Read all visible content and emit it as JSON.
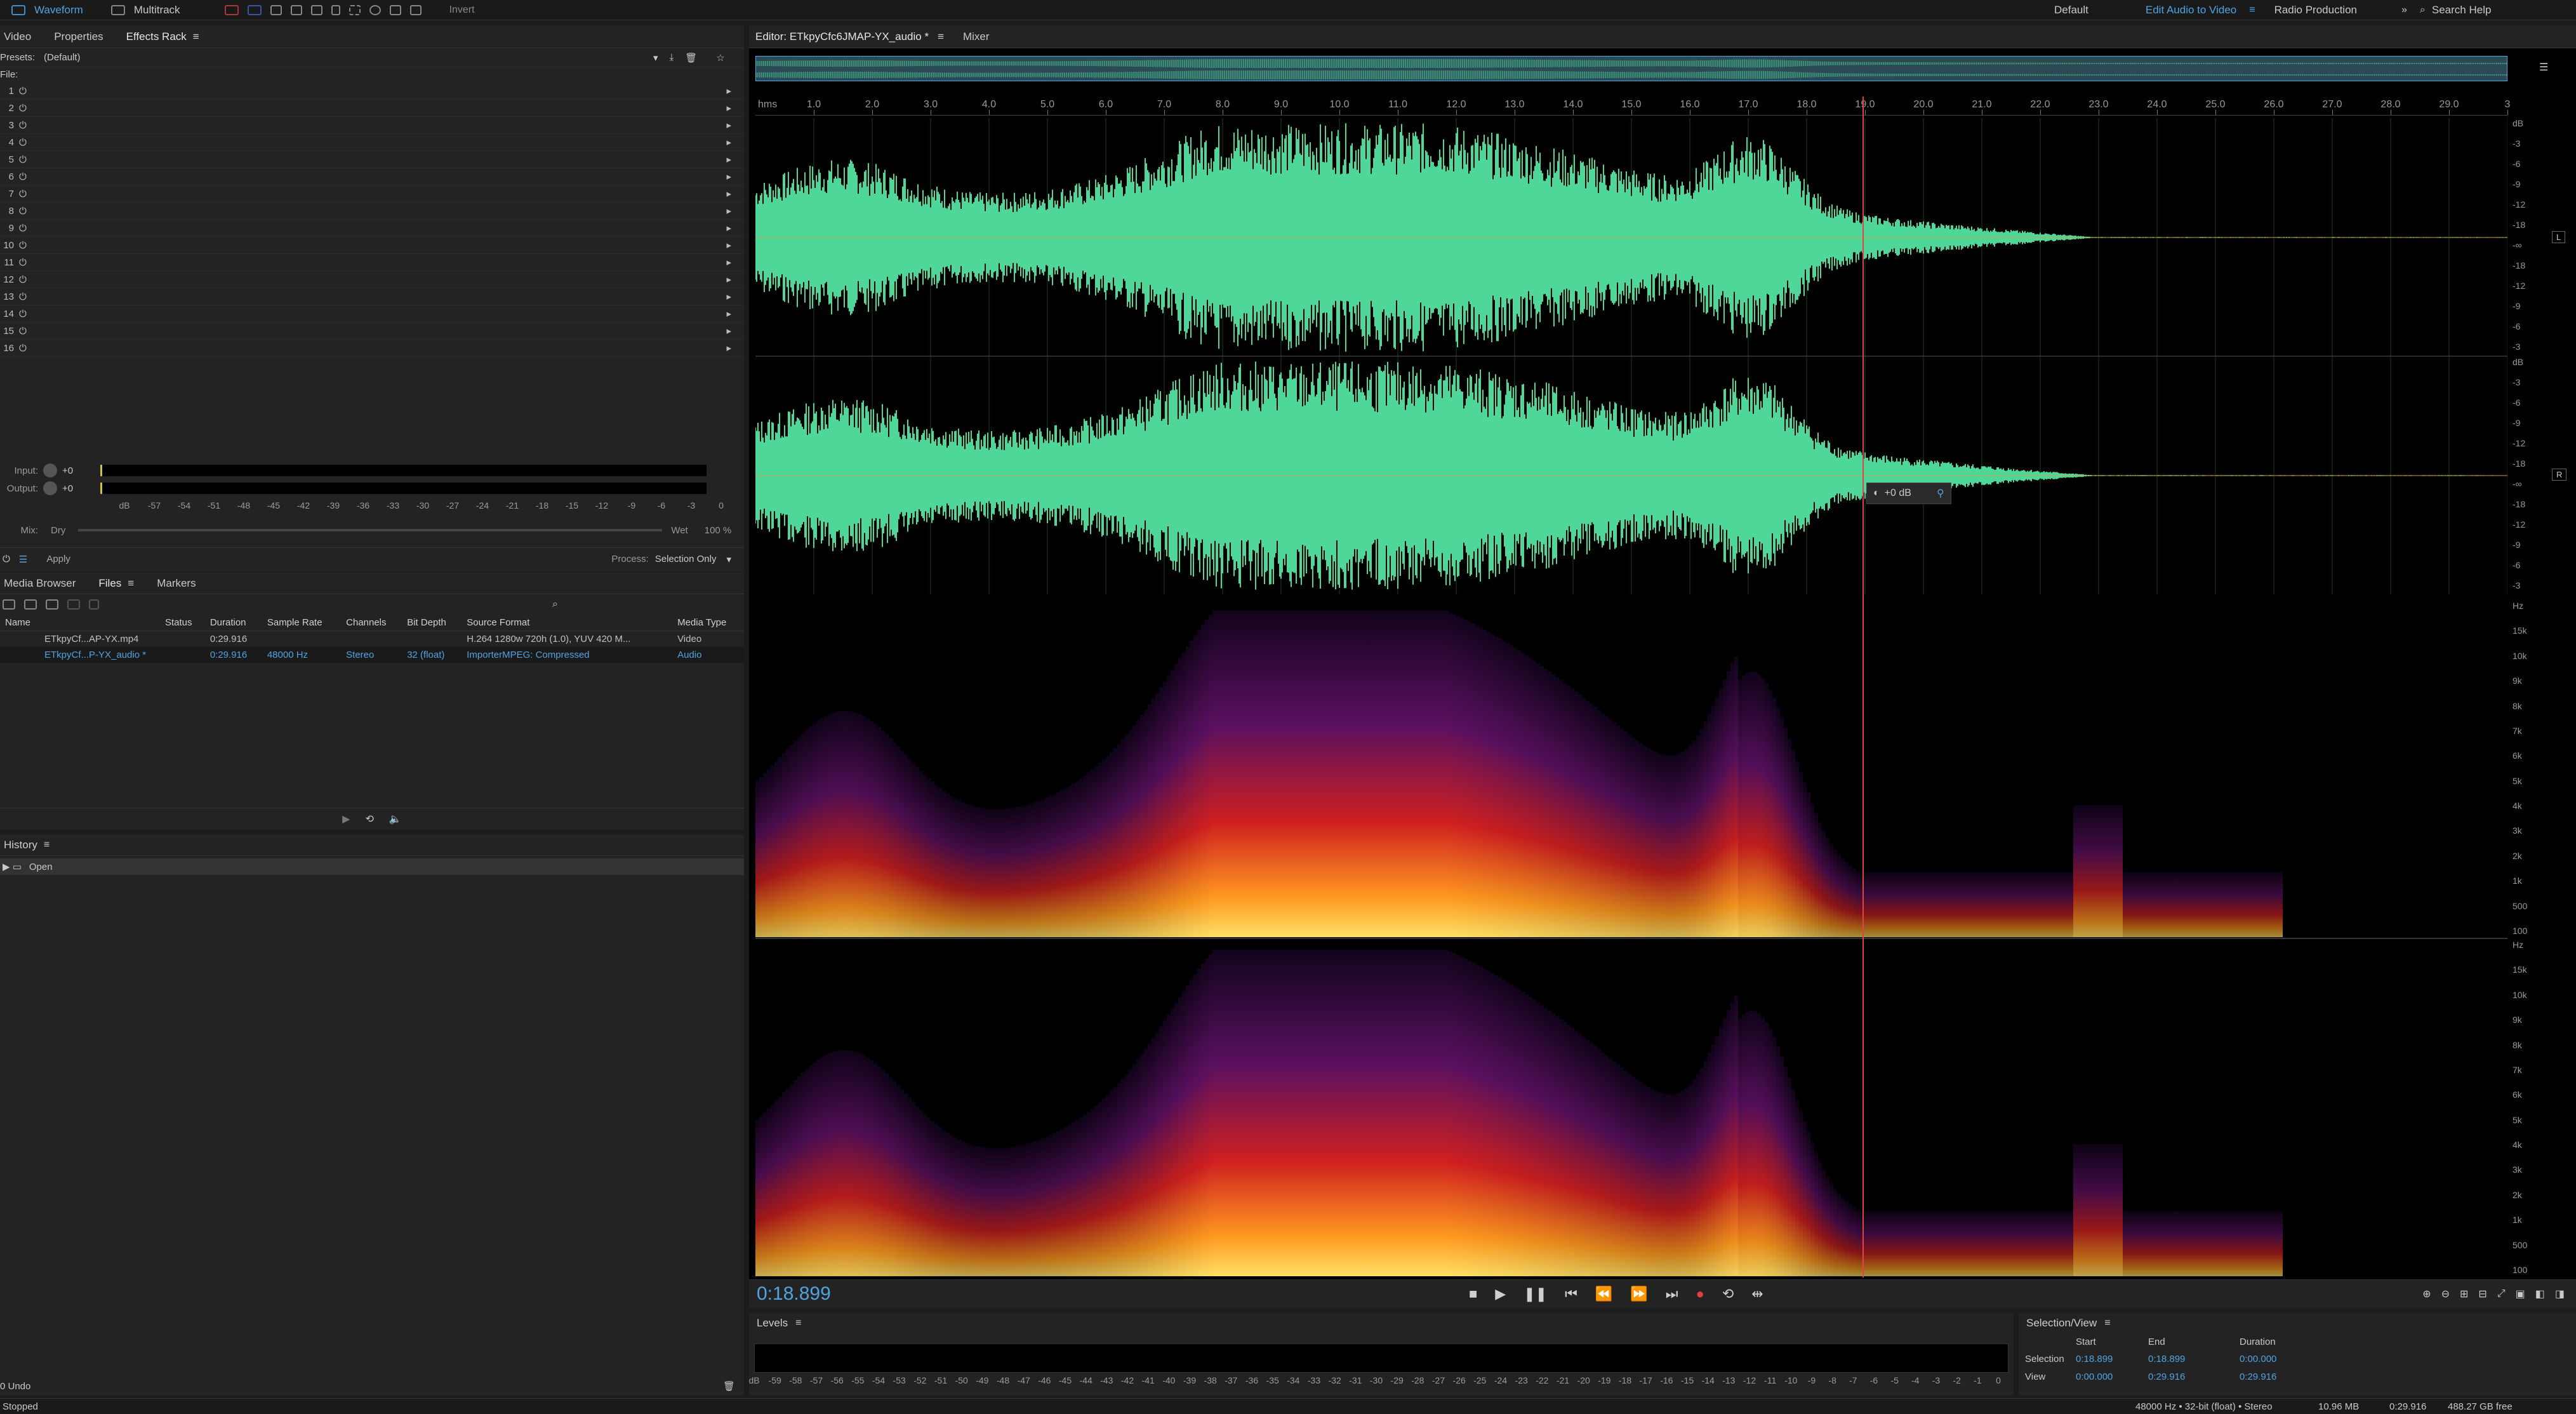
{
  "topbar": {
    "mode_waveform": "Waveform",
    "mode_multitrack": "Multitrack",
    "invert": "Invert",
    "workspaces": [
      "Default",
      "Edit Audio to Video",
      "Radio Production"
    ],
    "active_workspace": "Edit Audio to Video",
    "search": "Search Help"
  },
  "left_tabs": [
    "Video",
    "Properties",
    "Effects Rack"
  ],
  "effects": {
    "presets_label": "Presets:",
    "presets_value": "(Default)",
    "file_label": "File:",
    "slots": [
      "1",
      "2",
      "3",
      "4",
      "5",
      "6",
      "7",
      "8",
      "9",
      "10",
      "11",
      "12",
      "13",
      "14",
      "15",
      "16"
    ],
    "input_label": "Input:",
    "output_label": "Output:",
    "gain_plus": "+0",
    "meter_scale": [
      "dB",
      "-57",
      "-54",
      "-51",
      "-48",
      "-45",
      "-42",
      "-39",
      "-36",
      "-33",
      "-30",
      "-27",
      "-24",
      "-21",
      "-18",
      "-15",
      "-12",
      "-9",
      "-6",
      "-3",
      "0"
    ],
    "mix_label": "Mix:",
    "dry": "Dry",
    "wet": "Wet",
    "wet_pct": "100 %",
    "apply": "Apply",
    "process_label": "Process:",
    "process_value": "Selection Only"
  },
  "files": {
    "tabs": [
      "Media Browser",
      "Files",
      "Markers"
    ],
    "columns": [
      "Name",
      "Status",
      "Duration",
      "Sample Rate",
      "Channels",
      "Bit Depth",
      "Source Format",
      "Media Type"
    ],
    "rows": [
      {
        "name": "ETkpyCf...AP-YX.mp4",
        "status": "",
        "duration": "0:29.916",
        "rate": "",
        "channels": "",
        "depth": "",
        "format": "H.264 1280w 720h (1.0), YUV 420 M...",
        "type": "Video"
      },
      {
        "name": "ETkpyCf...P-YX_audio *",
        "status": "",
        "duration": "0:29.916",
        "rate": "48000 Hz",
        "channels": "Stereo",
        "depth": "32 (float)",
        "format": "ImporterMPEG: Compressed",
        "type": "Audio"
      }
    ]
  },
  "history": {
    "title": "History",
    "items": [
      "Open"
    ],
    "undo": "0 Undo"
  },
  "editor": {
    "tab": "Editor: ETkpyCfc6JMAP-YX_audio *",
    "mixer": "Mixer",
    "ruler_unit": "hms",
    "ruler": [
      "1.0",
      "2.0",
      "3.0",
      "4.0",
      "5.0",
      "6.0",
      "7.0",
      "8.0",
      "9.0",
      "10.0",
      "11.0",
      "12.0",
      "13.0",
      "14.0",
      "15.0",
      "16.0",
      "17.0",
      "18.0",
      "19.0",
      "20.0",
      "21.0",
      "22.0",
      "23.0",
      "24.0",
      "25.0",
      "26.0",
      "27.0",
      "28.0",
      "29.0",
      "3"
    ],
    "db_scale": [
      "dB",
      "-3",
      "-6",
      "-9",
      "-12",
      "-18",
      "-∞",
      "-18",
      "-12",
      "-9",
      "-6",
      "-3"
    ],
    "hz_scale": [
      "Hz",
      "15k",
      "10k",
      "9k",
      "8k",
      "7k",
      "6k",
      "5k",
      "4k",
      "3k",
      "2k",
      "1k",
      "500",
      "100"
    ],
    "channel_l": "L",
    "channel_r": "R",
    "hud_gain": "+0 dB",
    "current_time": "0:18.899",
    "playhead_fraction": 0.632,
    "duration_s": 29.916,
    "waveform_color": "#4fd79a"
  },
  "levels": {
    "title": "Levels",
    "scale": [
      "dB",
      "-59",
      "-58",
      "-57",
      "-56",
      "-55",
      "-54",
      "-53",
      "-52",
      "-51",
      "-50",
      "-49",
      "-48",
      "-47",
      "-46",
      "-45",
      "-44",
      "-43",
      "-42",
      "-41",
      "-40",
      "-39",
      "-38",
      "-37",
      "-36",
      "-35",
      "-34",
      "-33",
      "-32",
      "-31",
      "-30",
      "-29",
      "-28",
      "-27",
      "-26",
      "-25",
      "-24",
      "-23",
      "-22",
      "-21",
      "-20",
      "-19",
      "-18",
      "-17",
      "-16",
      "-15",
      "-14",
      "-13",
      "-12",
      "-11",
      "-10",
      "-9",
      "-8",
      "-7",
      "-6",
      "-5",
      "-4",
      "-3",
      "-2",
      "-1",
      "0"
    ]
  },
  "selection_view": {
    "title": "Selection/View",
    "headers": [
      "Start",
      "End",
      "Duration"
    ],
    "selection_label": "Selection",
    "selection": [
      "0:18.899",
      "0:18.899",
      "0:00.000"
    ],
    "view_label": "View",
    "view": [
      "0:00.000",
      "0:29.916",
      "0:29.916"
    ]
  },
  "status": {
    "state": "Stopped",
    "format": "48000 Hz • 32-bit (float) • Stereo",
    "size": "10.96 MB",
    "duration": "0:29.916",
    "free": "488.27 GB free"
  }
}
